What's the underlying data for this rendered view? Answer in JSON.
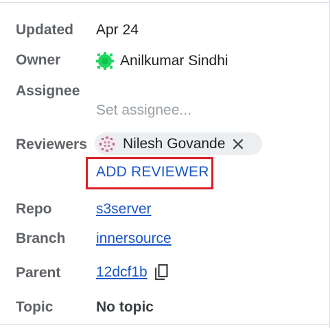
{
  "fields": {
    "updated": {
      "label": "Updated",
      "value": "Apr 24"
    },
    "owner": {
      "label": "Owner",
      "name": "Anilkumar Sindhi",
      "avatar_color": "#1ed760"
    },
    "assignee": {
      "label": "Assignee",
      "placeholder": "Set assignee..."
    },
    "reviewers": {
      "label": "Reviewers",
      "items": [
        {
          "name": "Nilesh Govande",
          "avatar_color": "#b06a85"
        }
      ],
      "add_label": "ADD REVIEWER"
    },
    "repo": {
      "label": "Repo",
      "value": "s3server"
    },
    "branch": {
      "label": "Branch",
      "value": "innersource"
    },
    "parent": {
      "label": "Parent",
      "value": "12dcf1b"
    },
    "topic": {
      "label": "Topic",
      "value": "No topic"
    }
  },
  "colors": {
    "link": "#1a56c9",
    "highlight_box": "#dc1f26",
    "chip_bg": "#eceff1"
  },
  "icons": {
    "owner_avatar": "identicon-green",
    "reviewer_avatar": "identicon-mauve",
    "remove": "close-icon",
    "copy": "copy-icon"
  }
}
